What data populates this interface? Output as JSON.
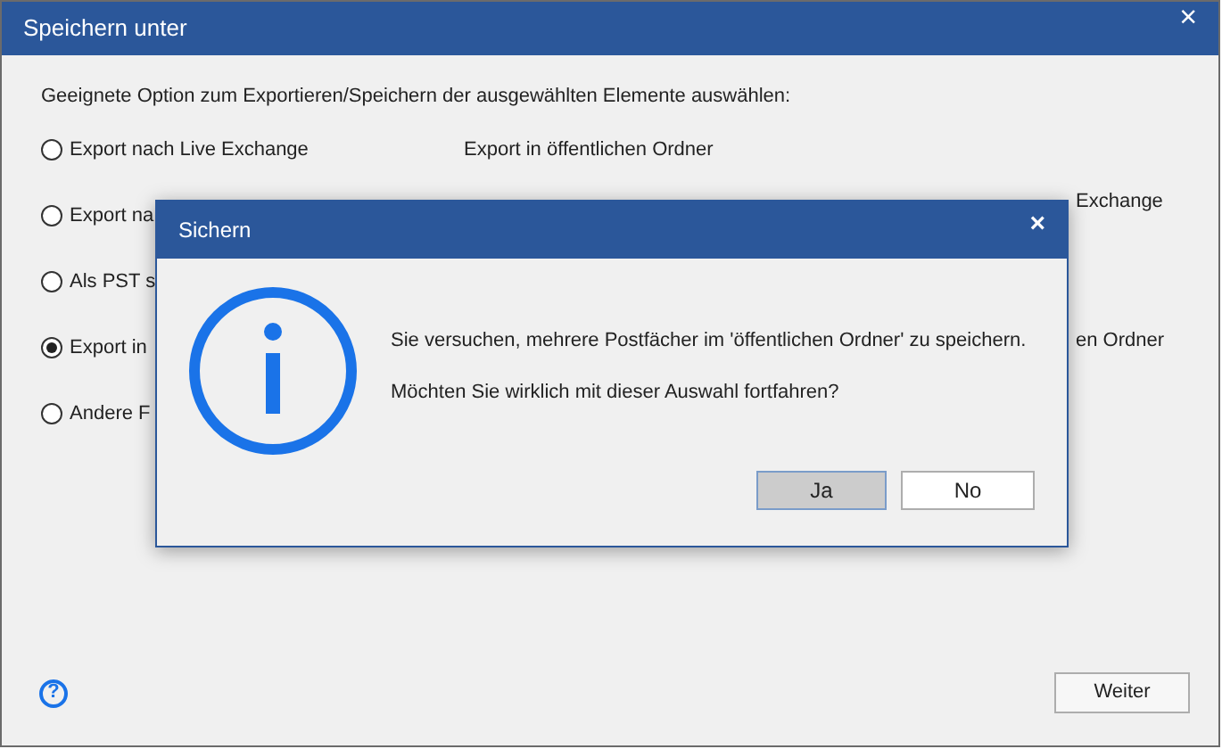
{
  "window": {
    "title": "Speichern unter"
  },
  "instruction": "Geeignete Option zum Exportieren/Speichern der ausgewählten Elemente auswählen:",
  "options": [
    {
      "label": "Export nach Live Exchange",
      "selected": false
    },
    {
      "label": "Export na",
      "selected": false
    },
    {
      "label": "Als PST s",
      "selected": false
    },
    {
      "label": "Export in",
      "selected": true
    },
    {
      "label": "Andere F",
      "selected": false
    }
  ],
  "description": {
    "title": "Export in öffentlichen Ordner",
    "fragments": [
      "Exchange",
      "en Ordner"
    ]
  },
  "buttons": {
    "next": "Weiter",
    "help": "?"
  },
  "modal": {
    "title": "Sichern",
    "close": "×",
    "messages": [
      "Sie versuchen, mehrere Postfächer im 'öffentlichen Ordner' zu speichern.",
      "Möchten Sie wirklich mit dieser Auswahl fortfahren?"
    ],
    "buttons": [
      {
        "label": "Ja",
        "selected": true
      },
      {
        "label": "No",
        "selected": false
      }
    ]
  },
  "window_close": "×"
}
